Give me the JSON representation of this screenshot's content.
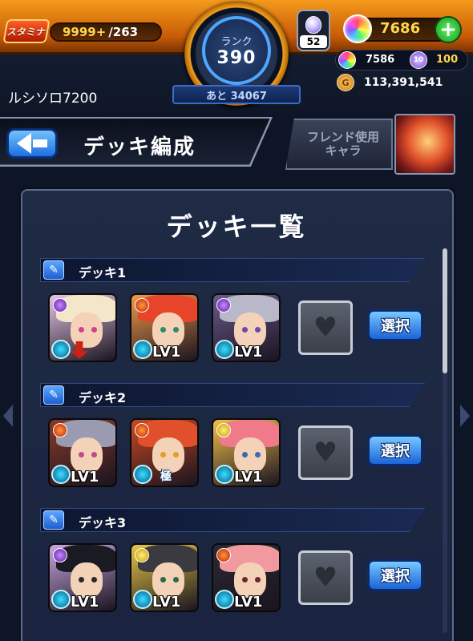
{
  "header": {
    "stamina_label": "スタミナ",
    "stamina_current": "9999+",
    "stamina_max": "/263",
    "rank_label": "ランク",
    "rank_value": "390",
    "exp_remaining": "あと 34067",
    "egg_count": "52",
    "orb_value": "7686",
    "plus_symbol": "+",
    "orb_sub_value": "7586",
    "ticket_label": "10",
    "ticket_value": "100",
    "coin_label": "G",
    "coin_value": "113,391,541",
    "player_name": "ルシソロ7200"
  },
  "title_bar": {
    "title": "デッキ編成",
    "friend_button": "フレンド使用\nキャラ"
  },
  "panel": {
    "title": "デッキ一覧",
    "select_label": "選択",
    "decks": [
      {
        "name": "デッキ1",
        "slots": [
          {
            "element": "dark",
            "level": "",
            "hair": "#f4e6c8",
            "bg": "#e7c6e6",
            "eye": "#d4408a",
            "badge": "arrow"
          },
          {
            "element": "fire",
            "level": "LV1",
            "hair": "#e8442a",
            "bg": "#f29a4a",
            "eye": "#2a8a6a",
            "badge": ""
          },
          {
            "element": "dark",
            "level": "LV1",
            "hair": "#b8b8c8",
            "bg": "#6a5a8a",
            "eye": "#6a4aa8",
            "badge": ""
          }
        ]
      },
      {
        "name": "デッキ2",
        "slots": [
          {
            "element": "fire",
            "level": "LV1",
            "hair": "#9a9ab0",
            "bg": "#8a3a2a",
            "eye": "#c04a8a",
            "badge": ""
          },
          {
            "element": "fire",
            "level": "",
            "hair": "#e0502a",
            "bg": "#c84a22",
            "eye": "#e0a020",
            "badge": "kiwame"
          },
          {
            "element": "light",
            "level": "LV1",
            "hair": "#f07a8a",
            "bg": "#f2c04a",
            "eye": "#3a6ab0",
            "badge": ""
          }
        ]
      },
      {
        "name": "デッキ3",
        "slots": [
          {
            "element": "dark",
            "level": "LV1",
            "hair": "#1a1a22",
            "bg": "#c8a8e0",
            "eye": "#2a2a2a",
            "badge": ""
          },
          {
            "element": "light",
            "level": "LV1",
            "hair": "#3a3a40",
            "bg": "#e8c848",
            "eye": "#2a6a4a",
            "badge": ""
          },
          {
            "element": "fire",
            "level": "LV1",
            "hair": "#f09aa0",
            "bg": "#2a2a30",
            "eye": "#6a2a2a",
            "badge": ""
          }
        ]
      }
    ]
  },
  "icons": {
    "back": "back-arrow-icon",
    "pencil": "pencil-icon",
    "heart": "heart-icon"
  }
}
